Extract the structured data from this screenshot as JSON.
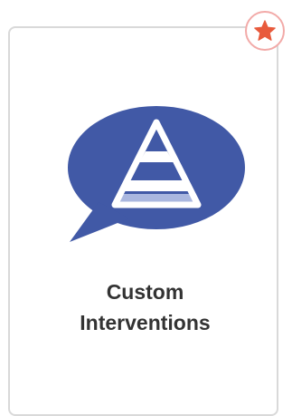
{
  "card": {
    "title_line1": "Custom",
    "title_line2": "Interventions",
    "icon": "pyramid-speech-bubble-icon",
    "favorite_icon": "star-icon"
  },
  "colors": {
    "bubble": "#4159a6",
    "pyramid_light": "#aab7df",
    "star": "#e85a3c",
    "badge_border": "#f2aaa8",
    "card_border": "#d9d9d9",
    "title_text": "#333333"
  }
}
